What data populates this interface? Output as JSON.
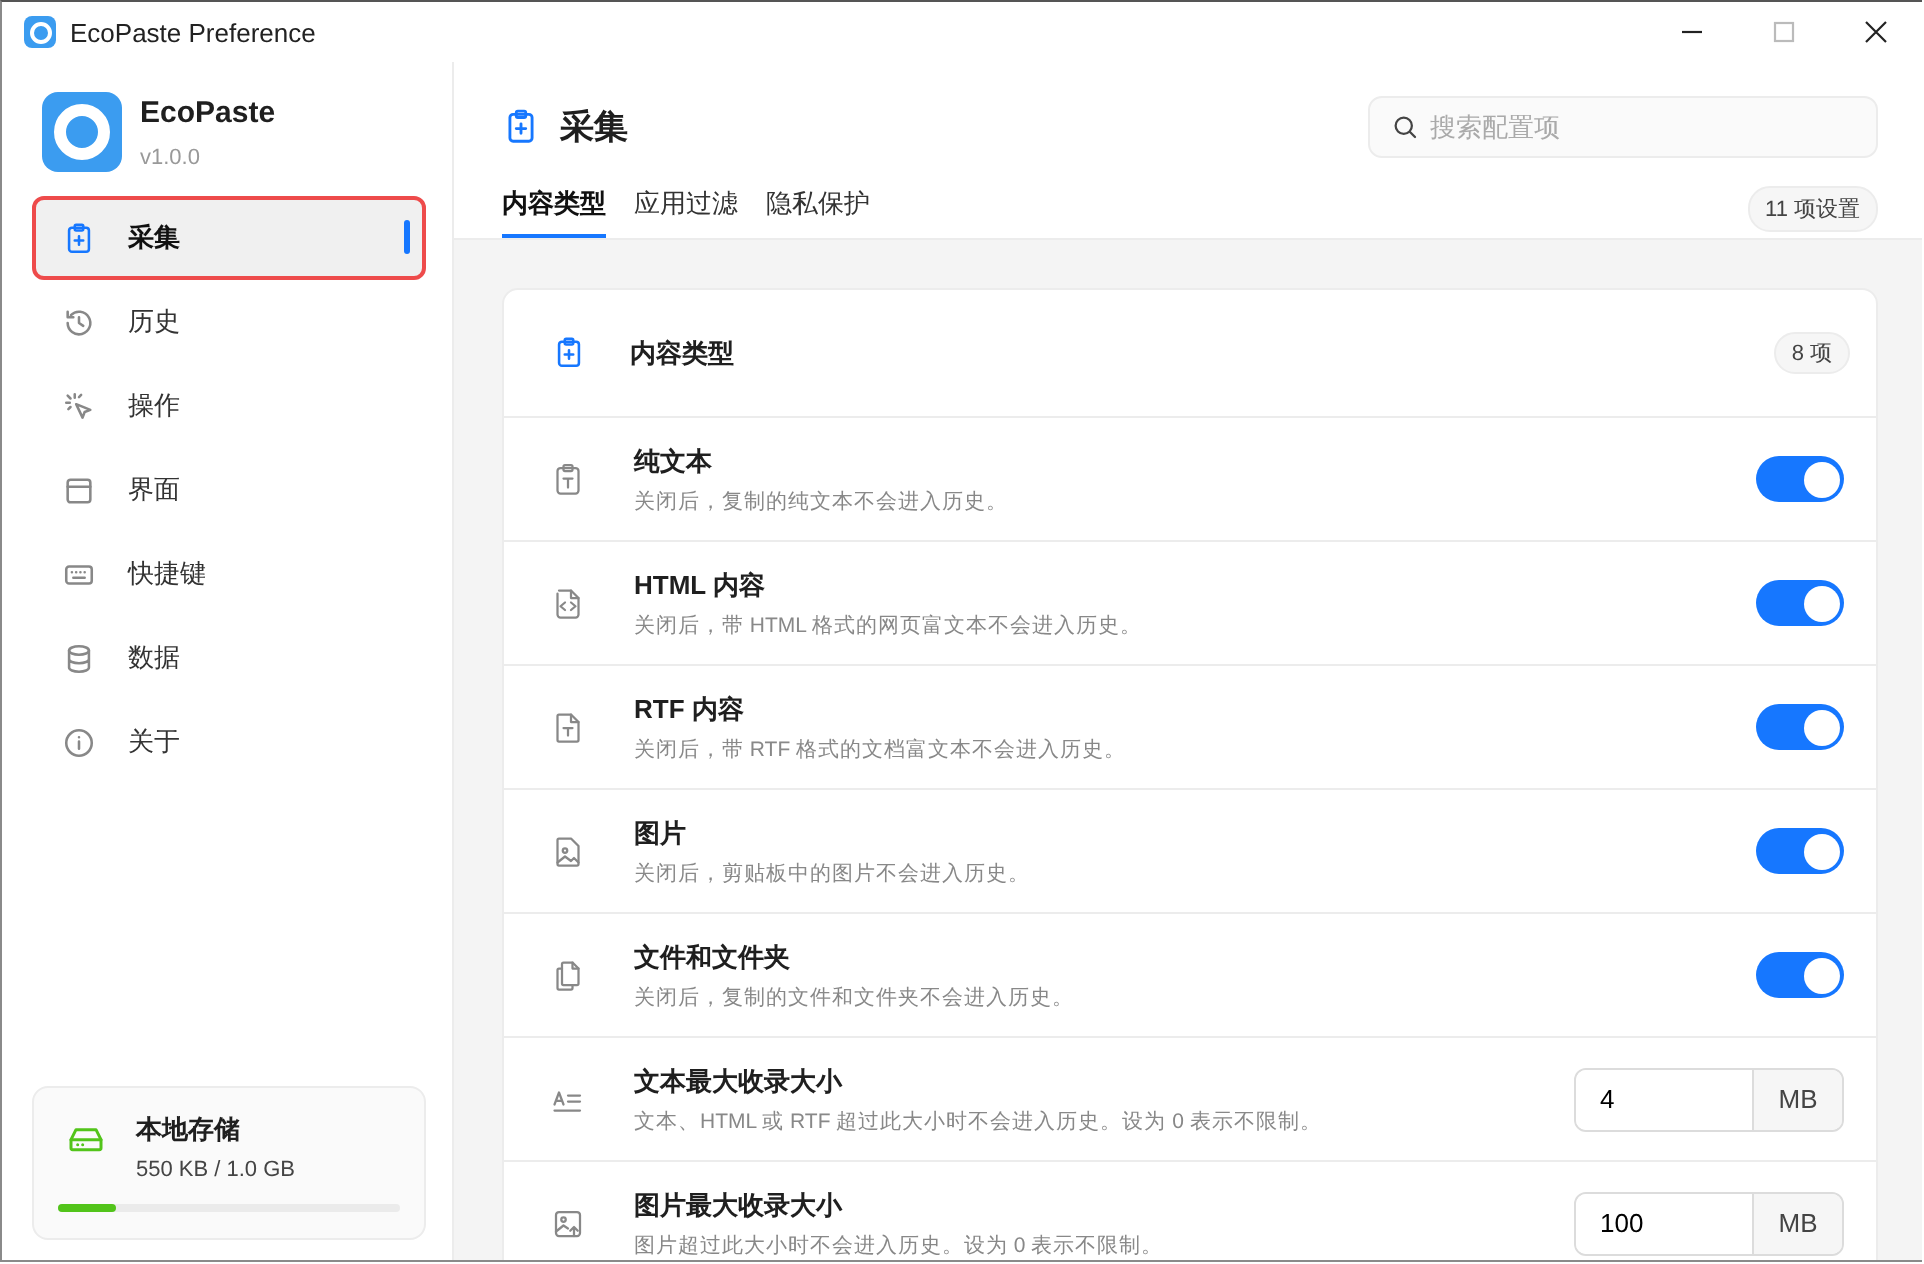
{
  "window": {
    "title": "EcoPaste Preference"
  },
  "app": {
    "name": "EcoPaste",
    "version": "v1.0.0"
  },
  "sidebar": {
    "items": [
      {
        "label": "采集",
        "selected": true,
        "highlighted": true
      },
      {
        "label": "历史",
        "selected": false,
        "highlighted": false
      },
      {
        "label": "操作",
        "selected": false,
        "highlighted": false
      },
      {
        "label": "界面",
        "selected": false,
        "highlighted": false
      },
      {
        "label": "快捷键",
        "selected": false,
        "highlighted": false
      },
      {
        "label": "数据",
        "selected": false,
        "highlighted": false
      },
      {
        "label": "关于",
        "selected": false,
        "highlighted": false
      }
    ],
    "storage": {
      "title": "本地存储",
      "usage": "550 KB / 1.0 GB",
      "level": 0.17
    }
  },
  "header": {
    "title": "采集",
    "search": {
      "placeholder": "搜索配置项"
    },
    "tabs": [
      {
        "label": "内容类型",
        "selected": true
      },
      {
        "label": "应用过滤",
        "selected": false
      },
      {
        "label": "隐私保护",
        "selected": false
      }
    ],
    "count": "11 项设置"
  },
  "card": {
    "title": "内容类型",
    "count": "8 项",
    "rows": [
      {
        "kind": "toggle",
        "title": "纯文本",
        "description": "关闭后，复制的纯文本不会进入历史。",
        "on": true
      },
      {
        "kind": "toggle",
        "title": "HTML 内容",
        "description": "关闭后，带 HTML 格式的网页富文本不会进入历史。",
        "on": true
      },
      {
        "kind": "toggle",
        "title": "RTF 内容",
        "description": "关闭后，带 RTF 格式的文档富文本不会进入历史。",
        "on": true
      },
      {
        "kind": "toggle",
        "title": "图片",
        "description": "关闭后，剪贴板中的图片不会进入历史。",
        "on": true
      },
      {
        "kind": "toggle",
        "title": "文件和文件夹",
        "description": "关闭后，复制的文件和文件夹不会进入历史。",
        "on": true
      },
      {
        "kind": "number",
        "title": "文本最大收录大小",
        "description": "文本、HTML 或 RTF 超过此大小时不会进入历史。设为 0 表示不限制。",
        "value": "4",
        "unit": "MB"
      },
      {
        "kind": "number",
        "title": "图片最大收录大小",
        "description": "图片超过此大小时不会进入历史。设为 0 表示不限制。",
        "value": "100",
        "unit": "MB"
      }
    ]
  }
}
